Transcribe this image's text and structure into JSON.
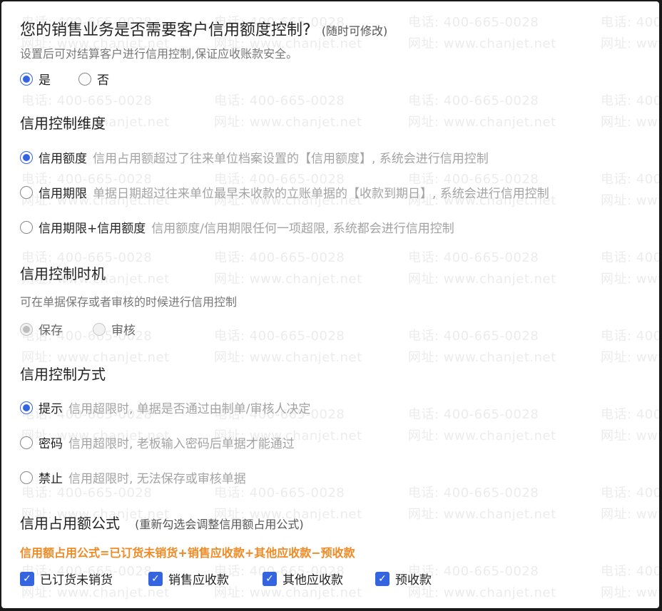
{
  "header": {
    "title": "您的销售业务是否需要客户信用额度控制?",
    "title_note": "(随时可修改)",
    "subtitle": "设置后可对结算客户进行信用控制,保证应收账款安全。"
  },
  "enable": {
    "options": [
      {
        "label": "是",
        "checked": true
      },
      {
        "label": "否",
        "checked": false
      }
    ]
  },
  "dimension": {
    "title": "信用控制维度",
    "options": [
      {
        "label": "信用额度",
        "desc": "信用占用额超过了往来单位档案设置的【信用额度】, 系统会进行信用控制",
        "checked": true
      },
      {
        "label": "信用期限",
        "desc": "单据日期超过往来单位最早未收款的立账单据的【收款到期日】, 系统会进行信用控制",
        "checked": false
      },
      {
        "label": "信用期限+信用额度",
        "desc": "信用额度/信用期限任何一项超限, 系统都会进行信用控制",
        "checked": false
      }
    ]
  },
  "timing": {
    "title": "信用控制时机",
    "subtitle": "可在单据保存或者审核的时候进行信用控制",
    "options": [
      {
        "label": "保存",
        "checked": true,
        "disabled": true
      },
      {
        "label": "审核",
        "checked": false,
        "disabled": true
      }
    ]
  },
  "method": {
    "title": "信用控制方式",
    "options": [
      {
        "label": "提示",
        "desc": "信用超限时, 单据是否通过由制单/审核人决定",
        "checked": true
      },
      {
        "label": "密码",
        "desc": "信用超限时, 老板输入密码后单据才能通过",
        "checked": false
      },
      {
        "label": "禁止",
        "desc": "信用超限时, 无法保存或审核单据",
        "checked": false
      }
    ]
  },
  "formula": {
    "title": "信用占用额公式",
    "title_note": "(重新勾选会调整信用额占用公式)",
    "text": "信用额占用公式=已订货未销货+销售应收款+其他应收款−预收款",
    "checks": [
      {
        "label": "已订货未销货",
        "checked": true
      },
      {
        "label": "销售应收款",
        "checked": true
      },
      {
        "label": "其他应收款",
        "checked": true
      },
      {
        "label": "预收款",
        "checked": true
      }
    ]
  },
  "watermark": {
    "phone": "电话: 400-665-0028",
    "site": "网址: www.chanjet.net"
  },
  "colors": {
    "accent": "#3564e0",
    "formula": "#f08a24",
    "description": "#a3a3a3"
  }
}
